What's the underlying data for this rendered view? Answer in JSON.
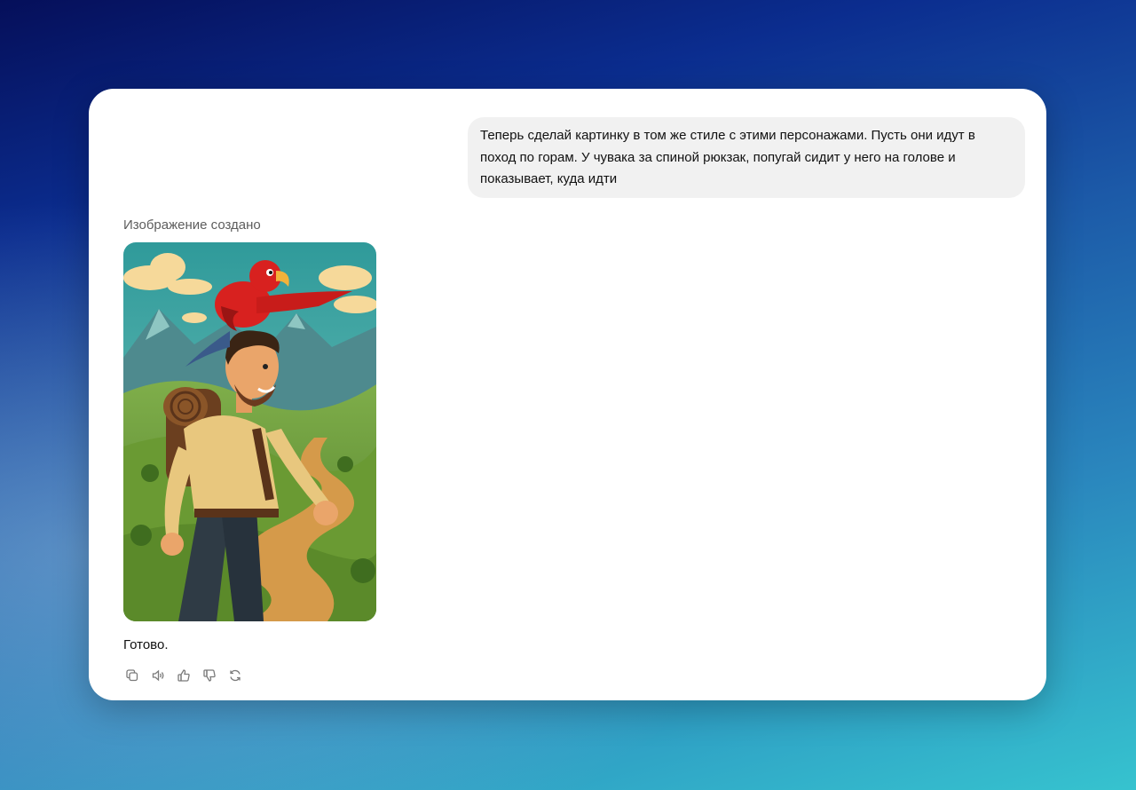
{
  "conversation": {
    "user_message": "Теперь сделай картинку в том же стиле с этими персонажами. Пусть они идут в поход по горам. У чувака за спиной рюкзак, попугай сидит у него на голове и показывает, куда идти",
    "image_status": "Изображение создано",
    "assistant_reply": "Готово."
  },
  "actions": [
    {
      "icon": "copy-icon"
    },
    {
      "icon": "speaker-icon"
    },
    {
      "icon": "thumbs-up-icon"
    },
    {
      "icon": "thumbs-down-icon"
    },
    {
      "icon": "regenerate-icon"
    }
  ],
  "colors": {
    "user_bubble": "#f1f1f1",
    "status_text": "#5d5d5d",
    "icon": "#7a7a7a"
  }
}
